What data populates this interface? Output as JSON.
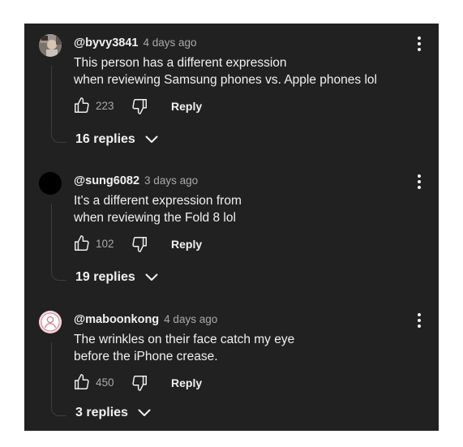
{
  "comments": [
    {
      "handle": "@byvy3841",
      "time": "4 days ago",
      "text_lines": [
        "This person has a different expression",
        "when reviewing Samsung phones vs. Apple phones lol"
      ],
      "like_count": "223",
      "reply_label": "Reply",
      "replies_label": "16 replies",
      "avatar_icon": "profile-photo-avatar"
    },
    {
      "handle": "@sung6082",
      "time": "3 days ago",
      "text_lines": [
        "It's a different expression from",
        "when reviewing the Fold 8 lol"
      ],
      "like_count": "102",
      "reply_label": "Reply",
      "replies_label": "19 replies",
      "avatar_icon": "black-circle-avatar"
    },
    {
      "handle": "@maboonkong",
      "time": "4 days ago",
      "text_lines": [
        "The wrinkles on their face catch my eye",
        "before the iPhone crease."
      ],
      "like_count": "450",
      "reply_label": "Reply",
      "replies_label": "3 replies",
      "avatar_icon": "default-user-avatar"
    }
  ],
  "icons": {
    "like": "thumbs-up-icon",
    "dislike": "thumbs-down-icon",
    "more": "more-vertical-icon",
    "expand": "chevron-down-icon"
  },
  "colors": {
    "background": "#212121",
    "text": "#f1f1f1",
    "secondary_text": "#aaaaaa",
    "default_avatar_bg": "#f6d6dc",
    "default_avatar_fg": "#c98a96"
  }
}
